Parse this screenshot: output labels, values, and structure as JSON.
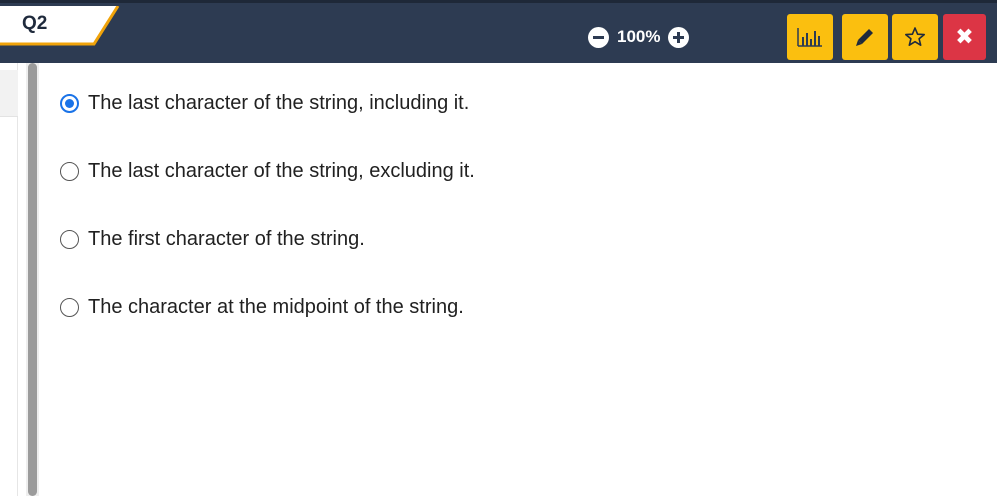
{
  "question_tab": {
    "label": "Q2"
  },
  "zoom": {
    "level": "100%",
    "decrease_icon": "minus-circle-icon",
    "increase_icon": "plus-circle-icon"
  },
  "toolbar": {
    "stats_icon": "bar-chart-icon",
    "edit_icon": "pencil-icon",
    "bookmark_icon": "star-outline-icon",
    "close_icon": "close-icon",
    "close_glyph": "✖"
  },
  "colors": {
    "header_bg": "#2d3b52",
    "accent_yellow": "#fbbf0f",
    "close_red": "#dc3545",
    "radio_selected": "#1a73e8"
  },
  "answer_options": [
    {
      "text": "The last character of the string, including it.",
      "selected": true
    },
    {
      "text": "The last character of the string, excluding it.",
      "selected": false
    },
    {
      "text": "The first character of the string.",
      "selected": false
    },
    {
      "text": "The character at the midpoint of the string.",
      "selected": false
    }
  ]
}
